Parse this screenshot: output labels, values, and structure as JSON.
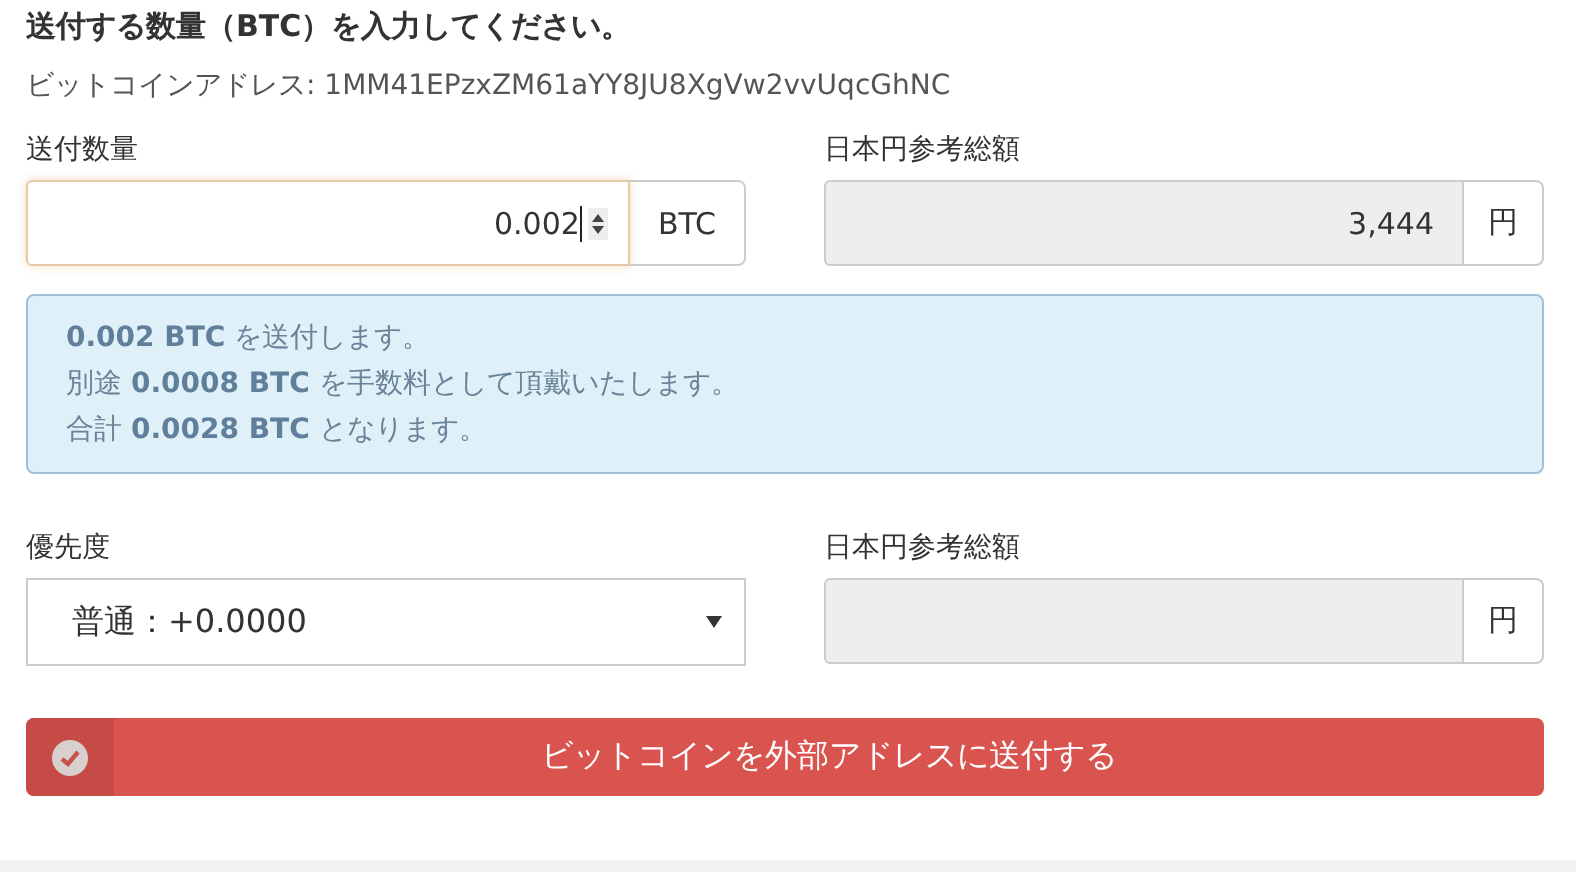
{
  "heading": "送付する数量（BTC）を入力してください。",
  "address_line": "ビットコインアドレス: 1MM41EPzxZM61aYY8JU8XgVw2vvUqcGhNC",
  "amount": {
    "label": "送付数量",
    "value": "0.002",
    "unit": "BTC",
    "focused": true
  },
  "jpy_total": {
    "label": "日本円参考総額",
    "value": "3,444",
    "unit": "円"
  },
  "notice": [
    "**0.002 BTC** を送付します。",
    "別途 **0.0008 BTC** を手数料として頂戴いたします。",
    "合計 **0.0028 BTC** となります。"
  ],
  "priority": {
    "label": "優先度",
    "value": "普通：+0.0000"
  },
  "jpy_fee": {
    "label": "日本円参考総額",
    "unit": "円"
  },
  "submit": {
    "label": "ビットコインを外部アドレスに送付する"
  }
}
